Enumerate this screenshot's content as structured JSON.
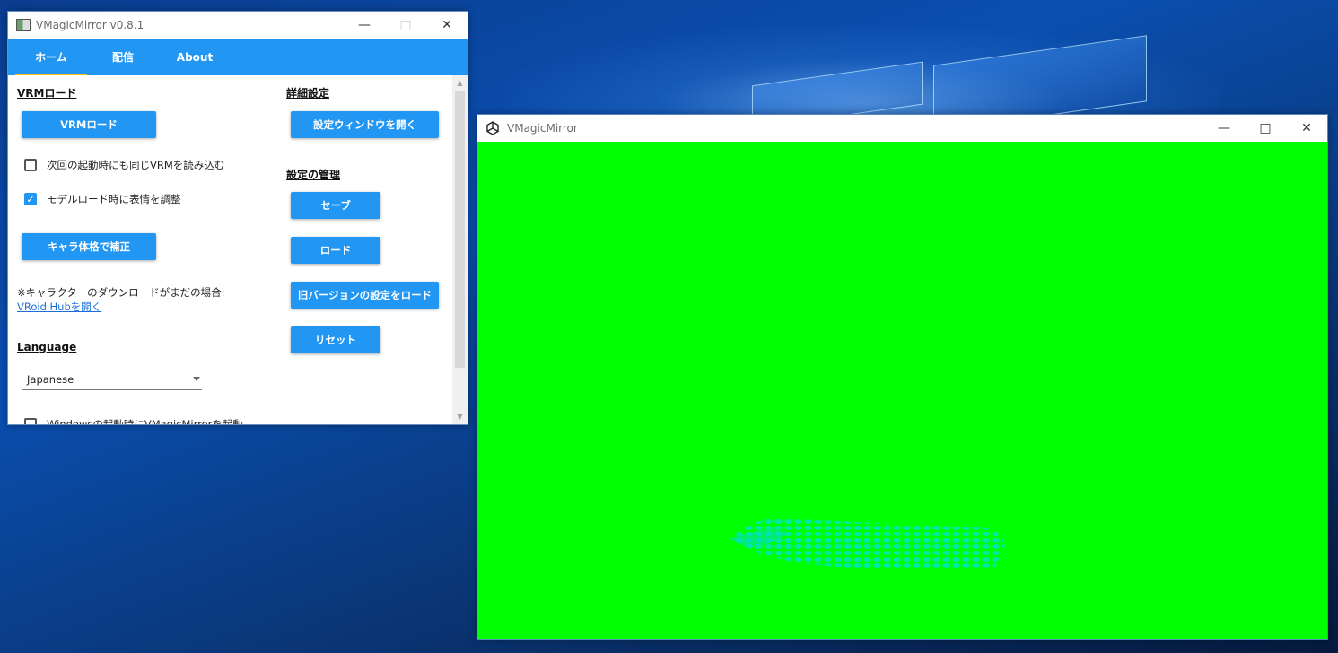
{
  "colors": {
    "accent": "#2196f3",
    "tab_indicator": "#ffc107",
    "greenscreen": "#00ff00"
  },
  "app": {
    "title": "VMagicMirror v0.8.1",
    "tabs": [
      {
        "label": "ホーム",
        "active": true
      },
      {
        "label": "配信",
        "active": false
      },
      {
        "label": "About",
        "active": false
      }
    ],
    "vrm": {
      "heading": "VRMロード",
      "load_button": "VRMロード",
      "auto_load_label": "次回の起動時にも同じVRMを読み込む",
      "auto_load_checked": false,
      "adjust_label": "モデルロード時に表情を調整",
      "adjust_checked": true,
      "calibrate_button": "キャラ体格で補正",
      "note": "※キャラクターのダウンロードがまだの場合:",
      "vroid_link": "VRoid Hubを開く"
    },
    "language": {
      "heading": "Language",
      "selected": "Japanese"
    },
    "clipped_row_label": "Windowsの起動時にVMagicMirrorを起動",
    "details": {
      "heading": "詳細設定",
      "open_button": "設定ウィンドウを開く"
    },
    "manage": {
      "heading": "設定の管理",
      "save_button": "セーブ",
      "load_button": "ロード",
      "legacy_button": "旧バージョンの設定をロード",
      "reset_button": "リセット"
    }
  },
  "unity": {
    "title": "VMagicMirror"
  }
}
